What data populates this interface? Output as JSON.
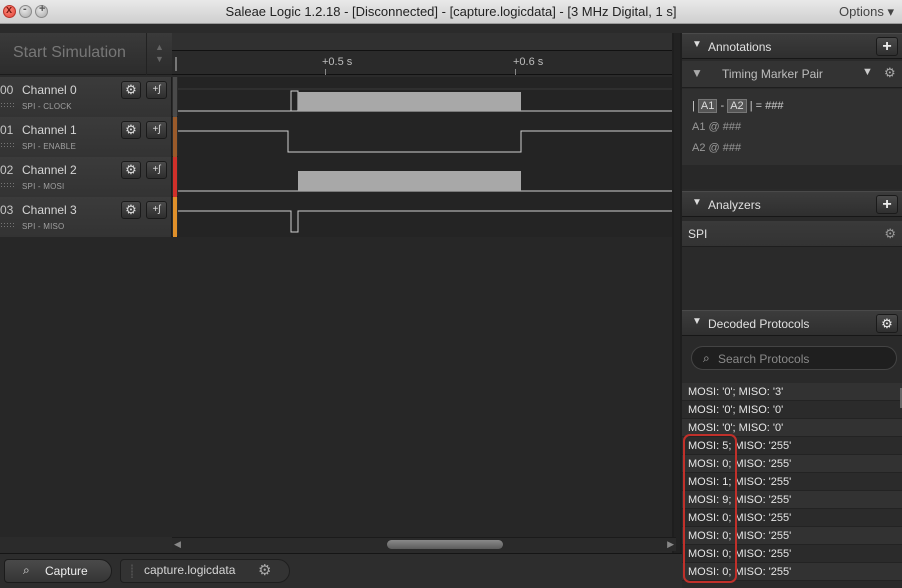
{
  "window": {
    "title": "Saleae Logic 1.2.18 - [Disconnected] - [capture.logicdata] - [3 MHz Digital, 1 s]",
    "options_label": "Options ▾",
    "close_glyph": "x",
    "min_glyph": "-",
    "max_glyph": "+"
  },
  "toolbar": {
    "start_label": "Start Simulation",
    "spin_up": "▲",
    "spin_down": "▼"
  },
  "timeline": {
    "ticks": [
      {
        "label": "+0.5 s"
      },
      {
        "label": "+0.6 s"
      }
    ]
  },
  "channels": [
    {
      "num": "00",
      "name": "Channel 0",
      "sub": "SPI - CLOCK",
      "color": "#4a4a4a"
    },
    {
      "num": "01",
      "name": "Channel 1",
      "sub": "SPI - ENABLE",
      "color": "#9a5a2a"
    },
    {
      "num": "02",
      "name": "Channel 2",
      "sub": "SPI - MOSI",
      "color": "#d0302a"
    },
    {
      "num": "03",
      "name": "Channel 3",
      "sub": "SPI - MISO",
      "color": "#e0902a"
    }
  ],
  "channel_gear": "⚙",
  "channel_trigger": "+ʃ",
  "scroll": {
    "left": "◀",
    "right": "▶"
  },
  "bottom": {
    "capture_icon": "⌕",
    "capture_label": "Capture",
    "file_label": "capture.logicdata",
    "gear": "⚙"
  },
  "annotations": {
    "header": "Annotations",
    "add": "+",
    "marker_pin": "▼",
    "marker_label": "Timing Marker Pair",
    "dropdown": "▼",
    "gear": "⚙",
    "line1_prefix": "|",
    "line1_a1": "A1",
    "line1_dash": "-",
    "line1_a2": "A2",
    "line1_suffix": "| = ###",
    "line2": "A1  @  ###",
    "line3": "A2  @  ###"
  },
  "analyzers": {
    "header": "Analyzers",
    "add": "+",
    "items": [
      {
        "label": "SPI"
      }
    ],
    "gear": "⚙"
  },
  "decoded": {
    "header": "Decoded Protocols",
    "gear": "⚙",
    "search_icon": "⌕",
    "search_placeholder": "Search Protocols",
    "rows": [
      "MOSI: '0';  MISO: '3'",
      "MOSI: '0';  MISO: '0'",
      "MOSI: '0';  MISO: '0'",
      "MOSI: 5;  MISO: '255'",
      "MOSI: 0;  MISO: '255'",
      "MOSI: 1;  MISO: '255'",
      "MOSI: 9;  MISO: '255'",
      "MOSI: 0;  MISO: '255'",
      "MOSI: 0;  MISO: '255'",
      "MOSI: 0;  MISO: '255'",
      "MOSI: 0;  MISO: '255'"
    ]
  },
  "triangle": "▼"
}
